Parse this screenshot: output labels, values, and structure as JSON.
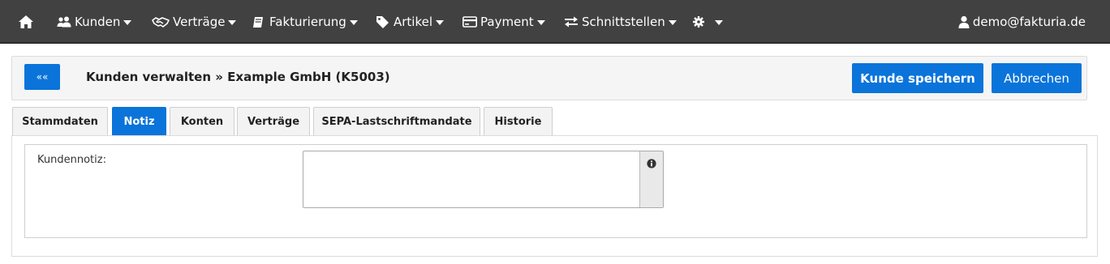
{
  "nav": {
    "items": [
      {
        "label": "Kunden",
        "icon": "users-icon"
      },
      {
        "label": "Verträge",
        "icon": "handshake-icon"
      },
      {
        "label": "Fakturierung",
        "icon": "book-icon"
      },
      {
        "label": "Artikel",
        "icon": "tags-icon"
      },
      {
        "label": "Payment",
        "icon": "credit-card-icon"
      },
      {
        "label": "Schnittstellen",
        "icon": "exchange-icon"
      }
    ],
    "user": "demo@fakturia.de"
  },
  "header": {
    "back_label": "««",
    "title": "Kunden verwalten » Example GmbH (K5003)",
    "save_label": "Kunde speichern",
    "cancel_label": "Abbrechen"
  },
  "tabs": [
    {
      "label": "Stammdaten",
      "active": false
    },
    {
      "label": "Notiz",
      "active": true
    },
    {
      "label": "Konten",
      "active": false
    },
    {
      "label": "Verträge",
      "active": false
    },
    {
      "label": "SEPA-Lastschriftmandate",
      "active": false
    },
    {
      "label": "Historie",
      "active": false
    }
  ],
  "form": {
    "note_label": "Kundennotiz:",
    "note_value": ""
  },
  "colors": {
    "navbar": "#414141",
    "accent": "#0a74da"
  }
}
